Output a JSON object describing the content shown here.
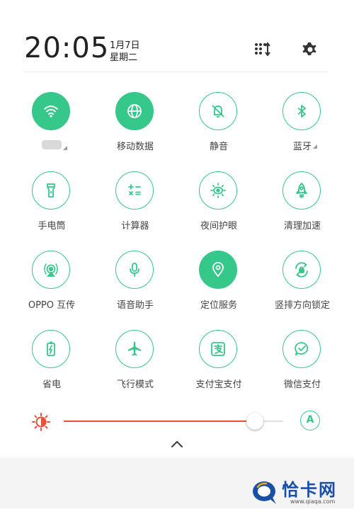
{
  "header": {
    "time": "20:05",
    "date": "1月7日",
    "weekday": "星期二",
    "edit_icon": "sort-grid-icon",
    "settings_icon": "gear-icon"
  },
  "colors": {
    "accent": "#36c78b",
    "brightness": "#e8503a",
    "watermark": "#1a4fa8"
  },
  "tiles": [
    {
      "label": "",
      "icon": "wifi-icon",
      "active": true
    },
    {
      "label": "移动数据",
      "icon": "globe-icon",
      "active": true
    },
    {
      "label": "静音",
      "icon": "bell-off-icon",
      "active": false
    },
    {
      "label": "蓝牙",
      "icon": "bluetooth-icon",
      "active": false
    },
    {
      "label": "手电筒",
      "icon": "flashlight-icon",
      "active": false
    },
    {
      "label": "计算器",
      "icon": "calculator-icon",
      "active": false
    },
    {
      "label": "夜间护眼",
      "icon": "eye-sun-icon",
      "active": false
    },
    {
      "label": "清理加速",
      "icon": "rocket-icon",
      "active": false
    },
    {
      "label": "OPPO 互传",
      "icon": "share-signal-icon",
      "active": false
    },
    {
      "label": "语音助手",
      "icon": "microphone-icon",
      "active": false
    },
    {
      "label": "定位服务",
      "icon": "location-pin-icon",
      "active": true
    },
    {
      "label": "竖排方向锁定",
      "icon": "rotation-lock-icon",
      "active": false
    },
    {
      "label": "省电",
      "icon": "battery-saver-icon",
      "active": false
    },
    {
      "label": "飞行模式",
      "icon": "airplane-icon",
      "active": false
    },
    {
      "label": "支付宝支付",
      "icon": "alipay-icon",
      "active": false
    },
    {
      "label": "微信支付",
      "icon": "wechat-pay-icon",
      "active": false
    }
  ],
  "brightness": {
    "level": 0.87,
    "auto_label": "A"
  },
  "watermark": {
    "text": "恰卡网",
    "url": "www.qiaqa.com"
  }
}
